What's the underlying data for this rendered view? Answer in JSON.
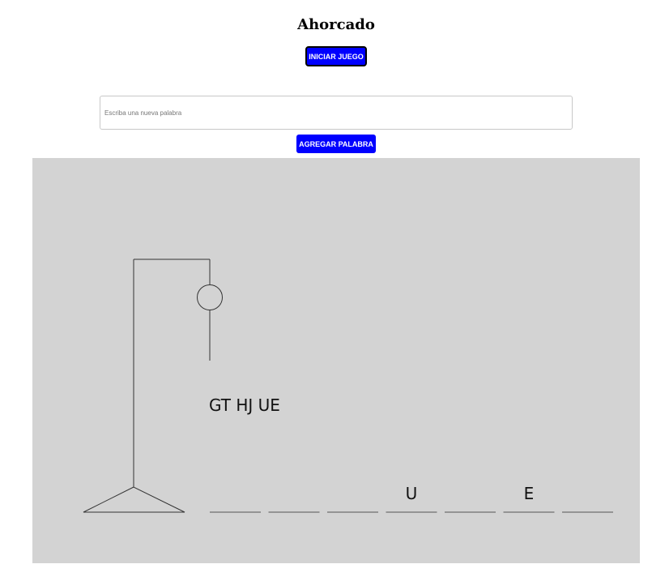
{
  "title": "Ahorcado",
  "start_button_label": "INICIAR JUEGO",
  "word_input": {
    "placeholder": "Escriba una nueva palabra",
    "value": ""
  },
  "add_button_label": "AGREGAR PALABRA",
  "game": {
    "wrong_letters": "GT HJ UE",
    "word_slots": [
      "",
      "",
      "",
      "U",
      "",
      "E",
      ""
    ],
    "drawn_parts": [
      "base",
      "pole",
      "beam",
      "rope",
      "head",
      "body"
    ]
  }
}
